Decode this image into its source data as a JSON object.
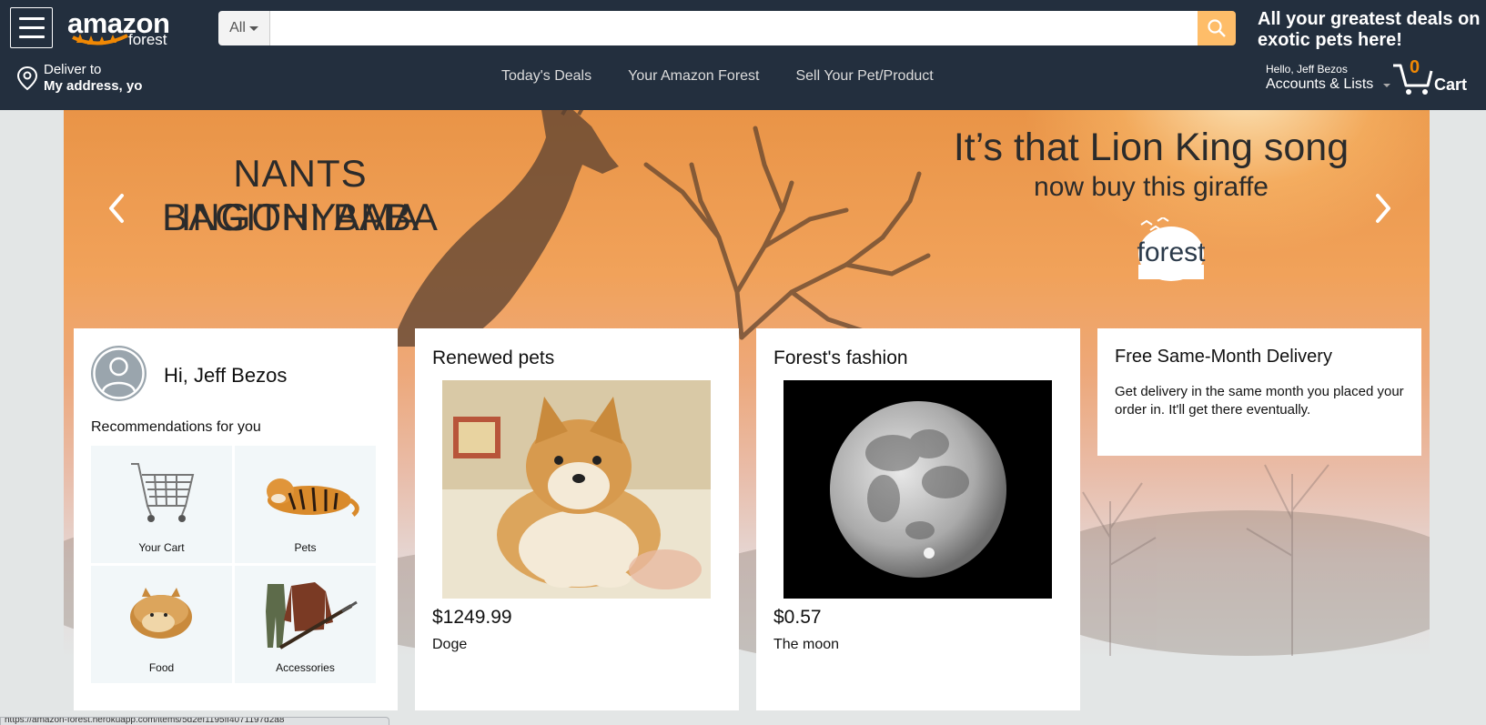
{
  "header": {
    "logo_text": "amazon",
    "logo_sub": "forest",
    "search": {
      "category": "All",
      "placeholder": "",
      "value": ""
    },
    "promo": "All your greatest deals on exotic pets here!",
    "deliver": {
      "line1": "Deliver to",
      "line2": "My address, yo"
    },
    "nav_links": [
      "Today's Deals",
      "Your Amazon Forest",
      "Sell Your Pet/Product"
    ],
    "account": {
      "hello": "Hello, Jeff Bezos",
      "label": "Accounts & Lists"
    },
    "cart": {
      "count": "0",
      "label": "Cart"
    }
  },
  "hero": {
    "left_line1": "NANTS INGONYAMA",
    "left_line2": "BAGITHI BABA",
    "right_line1": "It’s that Lion King song",
    "right_line2": "now buy this giraffe",
    "logo_text": "forest"
  },
  "greeting_card": {
    "name": "Hi, Jeff Bezos",
    "recommendations_title": "Recommendations for you",
    "tiles": [
      "Your Cart",
      "Pets",
      "Food",
      "Accessories"
    ]
  },
  "pets_card": {
    "title": "Renewed pets",
    "price": "$1249.99",
    "product": "Doge"
  },
  "fashion_card": {
    "title": "Forest's fashion",
    "price": "$0.57",
    "product": "The moon"
  },
  "delivery_card": {
    "title": "Free Same-Month Delivery",
    "body": "Get delivery in the same month you placed your order in. It'll get there eventually."
  },
  "status_bar": {
    "url": "https://amazon-forest.herokuapp.com/items/5d2ef1195ff4071197d2a8"
  },
  "colors": {
    "header_bg": "#232f3e",
    "search_button": "#febd69",
    "cart_count": "#f08804",
    "page_bg": "#e3e6e6"
  },
  "icons": [
    "hamburger-icon",
    "location-pin-icon",
    "search-icon",
    "cart-icon",
    "chevron-left-icon",
    "chevron-right-icon",
    "user-avatar-icon"
  ]
}
